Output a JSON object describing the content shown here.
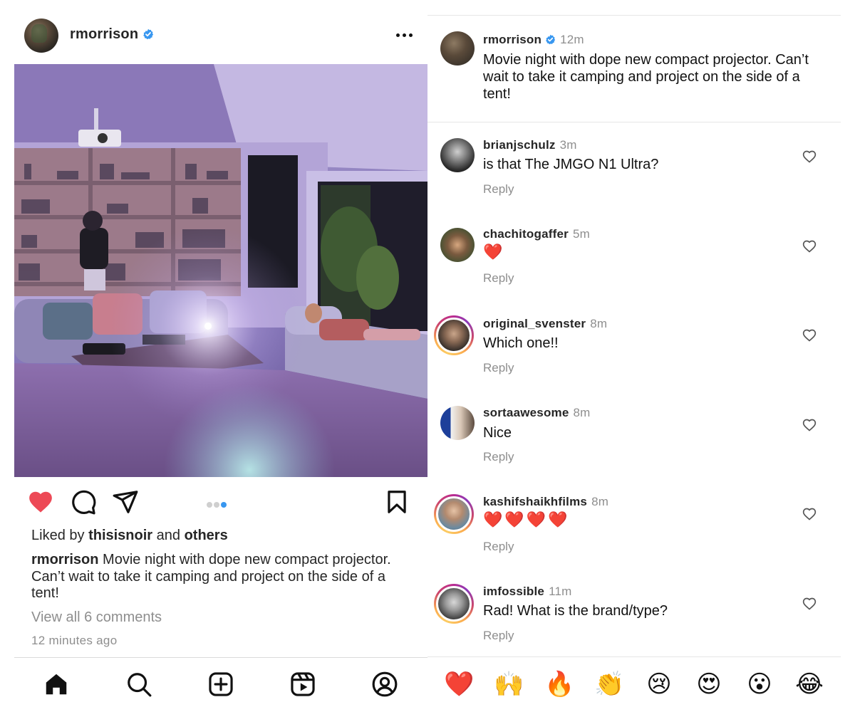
{
  "post": {
    "username": "rmorrison",
    "verified": true,
    "liked_by_prefix": "Liked by ",
    "liked_by_user": "thisisnoir",
    "liked_by_and": " and ",
    "liked_by_others": "others",
    "caption_user": "rmorrison",
    "caption_text": "Movie night with dope new compact projector.  Can’t wait to take it camping and project on the side of a tent!",
    "view_all_comments": "View all 6 comments",
    "time_ago": "12 minutes ago",
    "carousel": {
      "total": 3,
      "active_index": 3
    },
    "liked": true
  },
  "comments_panel": {
    "op": {
      "username": "rmorrison",
      "time": "12m",
      "text": "Movie night with dope new compact projector. Can’t wait to take it camping and project on the side of a tent!"
    },
    "comments": [
      {
        "username": "brianjschulz",
        "time": "3m",
        "text": "is that The JMGO N1 Ultra?",
        "reply": "Reply",
        "story_ring": false
      },
      {
        "username": "chachitogaffer",
        "time": "5m",
        "text": "❤️",
        "reply": "Reply",
        "story_ring": false
      },
      {
        "username": "original_svenster",
        "time": "8m",
        "text": "Which one!!",
        "reply": "Reply",
        "story_ring": true
      },
      {
        "username": "sortaawesome",
        "time": "8m",
        "text": "Nice",
        "reply": "Reply",
        "story_ring": false
      },
      {
        "username": "kashifshaikhfilms",
        "time": "8m",
        "text": "❤️❤️❤️❤️",
        "reply": "Reply",
        "story_ring": true
      },
      {
        "username": "imfossible",
        "time": "11m",
        "text": "Rad! What is the brand/type?",
        "reply": "Reply",
        "story_ring": true
      }
    ],
    "quick_emojis": [
      "❤️",
      "🙌",
      "🔥",
      "👏",
      "😢",
      "😍",
      "😮",
      "😂"
    ]
  },
  "colors": {
    "like_red": "#ed4956",
    "verified_blue": "#3897f0",
    "muted_text": "#8e8e8e"
  }
}
